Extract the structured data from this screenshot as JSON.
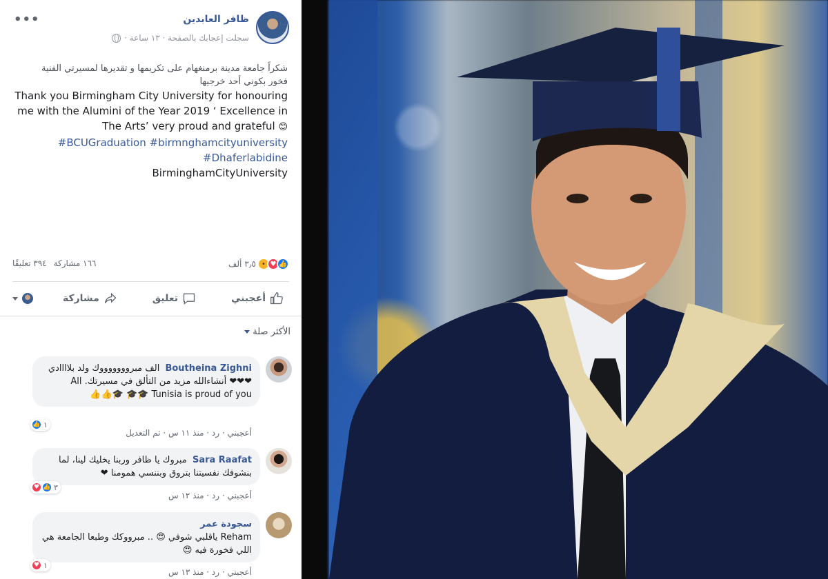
{
  "post": {
    "author": "ظافر العابدين",
    "meta": "سجلت إعجابك بالصفحة · ١٣ ساعة ·",
    "more_label": "•••",
    "text_ar_line1": "شكراً جامعة مدينة برمنغهام على تكريمها و تقديرها لمسيرتي الفنية",
    "text_ar_line2": "فخور بكوني أحد خرجيها",
    "text_en": "Thank you Birmingham City University for honouring me with the Alumini of the Year 2019 ‘ Excellence in The Arts’ very proud and grateful",
    "hashtags": [
      "#BCUGraduation",
      "#birmnghamcityuniversity",
      "#Dhaferlabidine",
      "BirminghamCityUniversity"
    ],
    "reaction_count": "٣٫٥ ألف",
    "comments_count": "٣٩٤ تعليقًا",
    "shares_count": "١٦٦ مشاركة"
  },
  "actions": {
    "like": "أعجبني",
    "comment": "تعليق",
    "share": "مشاركة"
  },
  "sort": {
    "label": "الأكثر صلة"
  },
  "comments": [
    {
      "name": "Boutheina Zighni",
      "text": "الف مبروووووووك ولد بلاااادي ❤❤❤ أنشاءالله مزيد من التألق في مسيرتك. All Tunisia is proud of you 🎓🎓 🎓👍👍",
      "sub": "أعجبني · رد · منذ ١١ س · تم التعديل",
      "reaction_count": "١"
    },
    {
      "name": "Sara Raafat",
      "text": "مبروك يا ظافر وربنا يخليك لينا، لما بنشوفك نفسيتنا بتروق وبننسي همومنا ❤",
      "sub": "أعجبني · رد · منذ ١٢ س",
      "reaction_count": "٣"
    },
    {
      "name": "سجودة عمر",
      "text": "Reham ياقلبي شوفي 😍 .. مبرووكك وطبعا الجامعة هي اللي فخورة فيه 😍",
      "sub": "أعجبني · رد · منذ ١٣ س",
      "reaction_count": "١"
    }
  ]
}
